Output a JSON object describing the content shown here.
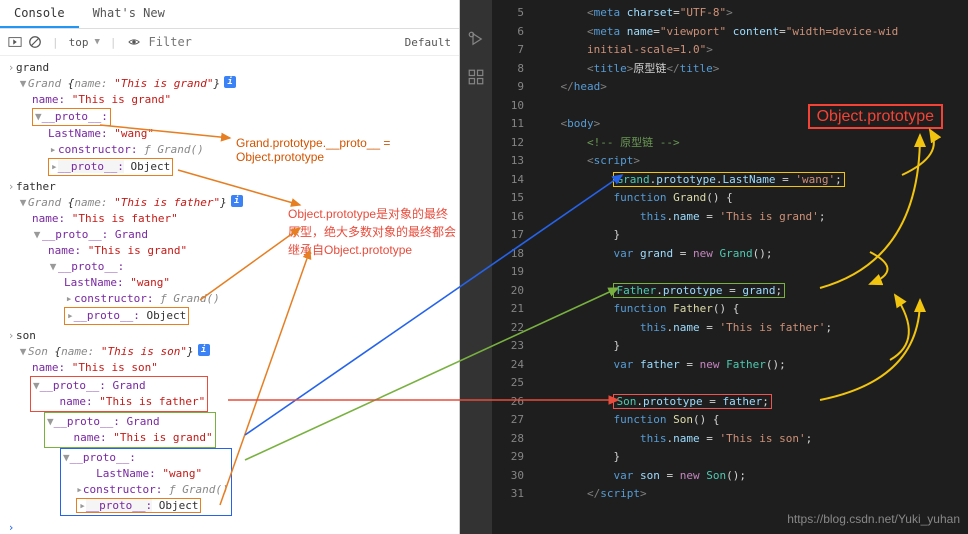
{
  "devtools": {
    "tabs": {
      "console": "Console",
      "whatsnew": "What's New"
    },
    "toolbar": {
      "context": "top",
      "filter_placeholder": "Filter",
      "levels": "Default"
    },
    "console": {
      "cmd1": "grand",
      "obj1_header": {
        "cls": "Grand",
        "open": "{",
        "name_k": "name:",
        "name_v": "\"This is grand\"",
        "close": "}"
      },
      "obj1_name": {
        "k": "name:",
        "v": "\"This is grand\""
      },
      "obj1_proto": "__proto__:",
      "obj1_lastname": {
        "k": "LastName:",
        "v": "\"wang\""
      },
      "obj1_constructor": {
        "k": "constructor:",
        "v": "ƒ Grand()"
      },
      "obj1_proto2": {
        "k": "__proto__:",
        "v": "Object"
      },
      "cmd2": "father",
      "obj2_header": {
        "cls": "Grand",
        "open": "{",
        "name_k": "name:",
        "name_v": "\"This is father\"",
        "close": "}"
      },
      "obj2_name": {
        "k": "name:",
        "v": "\"This is father\""
      },
      "obj2_proto": "__proto__: Grand",
      "obj2_name2": {
        "k": "name:",
        "v": "\"This is grand\""
      },
      "obj2_proto2": "__proto__:",
      "obj2_lastname": {
        "k": "LastName:",
        "v": "\"wang\""
      },
      "obj2_constructor": {
        "k": "constructor:",
        "v": "ƒ Grand()"
      },
      "obj2_proto3": {
        "k": "__proto__:",
        "v": "Object"
      },
      "cmd3": "son",
      "obj3_header": {
        "cls": "Son",
        "open": "{",
        "name_k": "name:",
        "name_v": "\"This is son\"",
        "close": "}"
      },
      "obj3_name": {
        "k": "name:",
        "v": "\"This is son\""
      },
      "obj3_proto": "__proto__: Grand",
      "obj3_name2": {
        "k": "name:",
        "v": "\"This is father\""
      },
      "obj3_proto2": "__proto__: Grand",
      "obj3_name3": {
        "k": "name:",
        "v": "\"This is grand\""
      },
      "obj3_proto3": "__proto__:",
      "obj3_lastname": {
        "k": "LastName:",
        "v": "\"wang\""
      },
      "obj3_constructor": {
        "k": "constructor:",
        "v": "ƒ Grand()"
      },
      "obj3_proto4": {
        "k": "__proto__:",
        "v": "Object"
      }
    },
    "annotations": {
      "a1": "Grand.prototype.__proto__ = Object.prototype",
      "a2": "Object.prototype是对象的最终原型，绝大多数对象的最终都会继承自Object.prototype"
    }
  },
  "editor": {
    "heading_box": "Object.prototype",
    "lines": {
      "5": {
        "pre": "        <",
        "meta": "meta",
        "sp": " ",
        "charset": "charset",
        "eq": "=",
        "val": "\"UTF-8\"",
        "end": ">"
      },
      "6": {
        "pre": "        <",
        "meta": "meta",
        "sp": " ",
        "name": "name",
        "eq": "=",
        "val1": "\"viewport\"",
        "sp2": " ",
        "content": "content",
        "val2": "\"width=device-wid",
        "cont": "initial-scale=1.0\"",
        "end": ">"
      },
      "7": {
        "pre": "        <",
        "title": "title",
        "gt": ">",
        "text": "原型链",
        "close": "</",
        "title2": "title",
        "end": ">"
      },
      "8": {
        "pre": "    </",
        "head": "head",
        "end": ">"
      },
      "10": {
        "pre": "    <",
        "body": "body",
        "end": ">"
      },
      "11": {
        "pre": "        ",
        "comment": "<!-- 原型链 -->"
      },
      "12": {
        "pre": "        <",
        "script": "script",
        "end": ">"
      },
      "13": {
        "pre": "            ",
        "grand": "Grand",
        "dot": ".",
        "proto": "prototype",
        "dot2": ".",
        "ln": "LastName",
        "eq": " = ",
        "val": "'wang'",
        "semi": ";"
      },
      "14": {
        "pre": "            ",
        "fn": "function",
        "sp": " ",
        "name": "Grand",
        "paren": "() {"
      },
      "15": {
        "pre": "                ",
        "this": "this",
        "dot": ".",
        "name": "name",
        "eq": " = ",
        "val": "'This is grand'",
        "semi": ";"
      },
      "16": {
        "pre": "            }",
        "close": ""
      },
      "17": {
        "pre": "            ",
        "var": "var",
        "sp": " ",
        "name": "grand",
        "eq": " = ",
        "new": "new",
        "sp2": " ",
        "cls": "Grand",
        "paren": "();"
      },
      "19": {
        "pre": "            ",
        "father": "Father",
        "dot": ".",
        "proto": "prototype",
        "eq": " = ",
        "val": "grand",
        "semi": ";"
      },
      "20": {
        "pre": "            ",
        "fn": "function",
        "sp": " ",
        "name": "Father",
        "paren": "() {"
      },
      "21": {
        "pre": "                ",
        "this": "this",
        "dot": ".",
        "name": "name",
        "eq": " = ",
        "val": "'This is father'",
        "semi": ";"
      },
      "22": {
        "pre": "            }",
        "close": ""
      },
      "23": {
        "pre": "            ",
        "var": "var",
        "sp": " ",
        "name": "father",
        "eq": " = ",
        "new": "new",
        "sp2": " ",
        "cls": "Father",
        "paren": "();"
      },
      "25": {
        "pre": "            ",
        "son": "Son",
        "dot": ".",
        "proto": "prototype",
        "eq": " = ",
        "val": "father",
        "semi": ";"
      },
      "26": {
        "pre": "            ",
        "fn": "function",
        "sp": " ",
        "name": "Son",
        "paren": "() {"
      },
      "27": {
        "pre": "                ",
        "this": "this",
        "dot": ".",
        "name": "name",
        "eq": " = ",
        "val": "'This is son'",
        "semi": ";"
      },
      "28": {
        "pre": "            }",
        "close": ""
      },
      "29": {
        "pre": "            ",
        "var": "var",
        "sp": " ",
        "name": "son",
        "eq": " = ",
        "new": "new",
        "sp2": " ",
        "cls": "Son",
        "paren": "();"
      },
      "30": {
        "pre": "        </",
        "script": "script",
        "end": ">"
      }
    },
    "line_numbers": [
      "5",
      "6",
      "",
      "7",
      "8",
      "9",
      "10",
      "11",
      "12",
      "13",
      "14",
      "15",
      "16",
      "17",
      "18",
      "19",
      "20",
      "21",
      "22",
      "23",
      "24",
      "25",
      "26",
      "27",
      "28",
      "29",
      "30",
      "31"
    ],
    "watermark": "https://blog.csdn.net/Yuki_yuhan"
  }
}
